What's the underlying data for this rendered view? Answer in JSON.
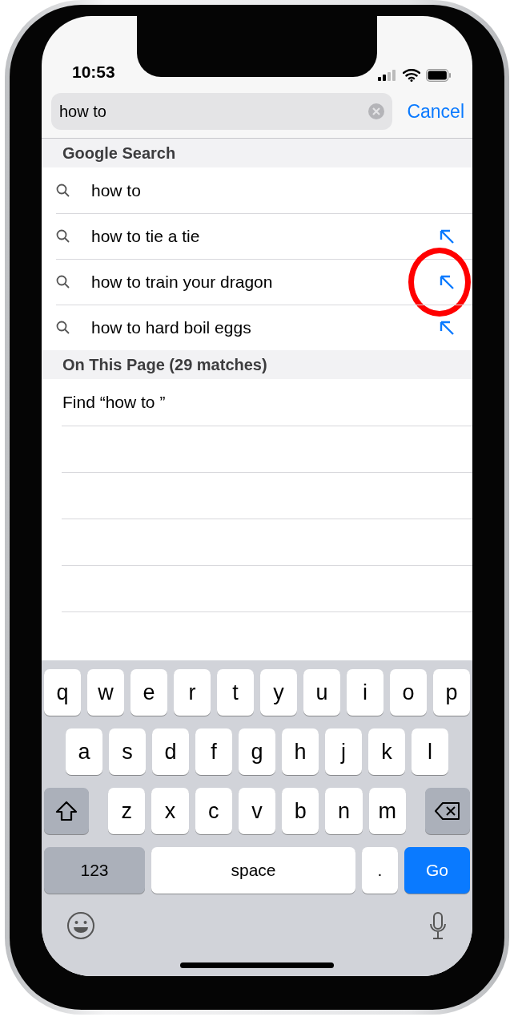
{
  "status_bar": {
    "time": "10:53"
  },
  "search": {
    "value": "how to",
    "cancel": "Cancel"
  },
  "sections": [
    {
      "title": "Google Search",
      "kind": "suggestions",
      "items": [
        {
          "text": "how to",
          "arrow": false,
          "highlighted": false
        },
        {
          "text": "how to tie a tie",
          "arrow": true,
          "highlighted": false
        },
        {
          "text": "how to train your dragon",
          "arrow": true,
          "highlighted": true
        },
        {
          "text": "how to hard boil eggs",
          "arrow": true,
          "highlighted": false
        }
      ]
    },
    {
      "title": "On This Page (29 matches)",
      "kind": "find",
      "items": [
        {
          "text": "Find “how to ”"
        }
      ]
    }
  ],
  "keyboard": {
    "rows": [
      {
        "keys": [
          {
            "kind": "letter",
            "label": "q"
          },
          {
            "kind": "letter",
            "label": "w"
          },
          {
            "kind": "letter",
            "label": "e"
          },
          {
            "kind": "letter",
            "label": "r"
          },
          {
            "kind": "letter",
            "label": "t"
          },
          {
            "kind": "letter",
            "label": "y"
          },
          {
            "kind": "letter",
            "label": "u"
          },
          {
            "kind": "letter",
            "label": "i"
          },
          {
            "kind": "letter",
            "label": "o"
          },
          {
            "kind": "letter",
            "label": "p"
          }
        ]
      },
      {
        "keys": [
          {
            "kind": "letter",
            "label": "a"
          },
          {
            "kind": "letter",
            "label": "s"
          },
          {
            "kind": "letter",
            "label": "d"
          },
          {
            "kind": "letter",
            "label": "f"
          },
          {
            "kind": "letter",
            "label": "g"
          },
          {
            "kind": "letter",
            "label": "h"
          },
          {
            "kind": "letter",
            "label": "j"
          },
          {
            "kind": "letter",
            "label": "k"
          },
          {
            "kind": "letter",
            "label": "l"
          }
        ]
      },
      {
        "keys": [
          {
            "kind": "shift"
          },
          {
            "kind": "letter",
            "label": "z"
          },
          {
            "kind": "letter",
            "label": "x"
          },
          {
            "kind": "letter",
            "label": "c"
          },
          {
            "kind": "letter",
            "label": "v"
          },
          {
            "kind": "letter",
            "label": "b"
          },
          {
            "kind": "letter",
            "label": "n"
          },
          {
            "kind": "letter",
            "label": "m"
          },
          {
            "kind": "delete"
          }
        ]
      },
      {
        "keys": [
          {
            "kind": "mode",
            "label": "123"
          },
          {
            "kind": "space",
            "label": "space"
          },
          {
            "kind": "period",
            "label": "."
          },
          {
            "kind": "go",
            "label": "Go"
          }
        ]
      }
    ]
  }
}
